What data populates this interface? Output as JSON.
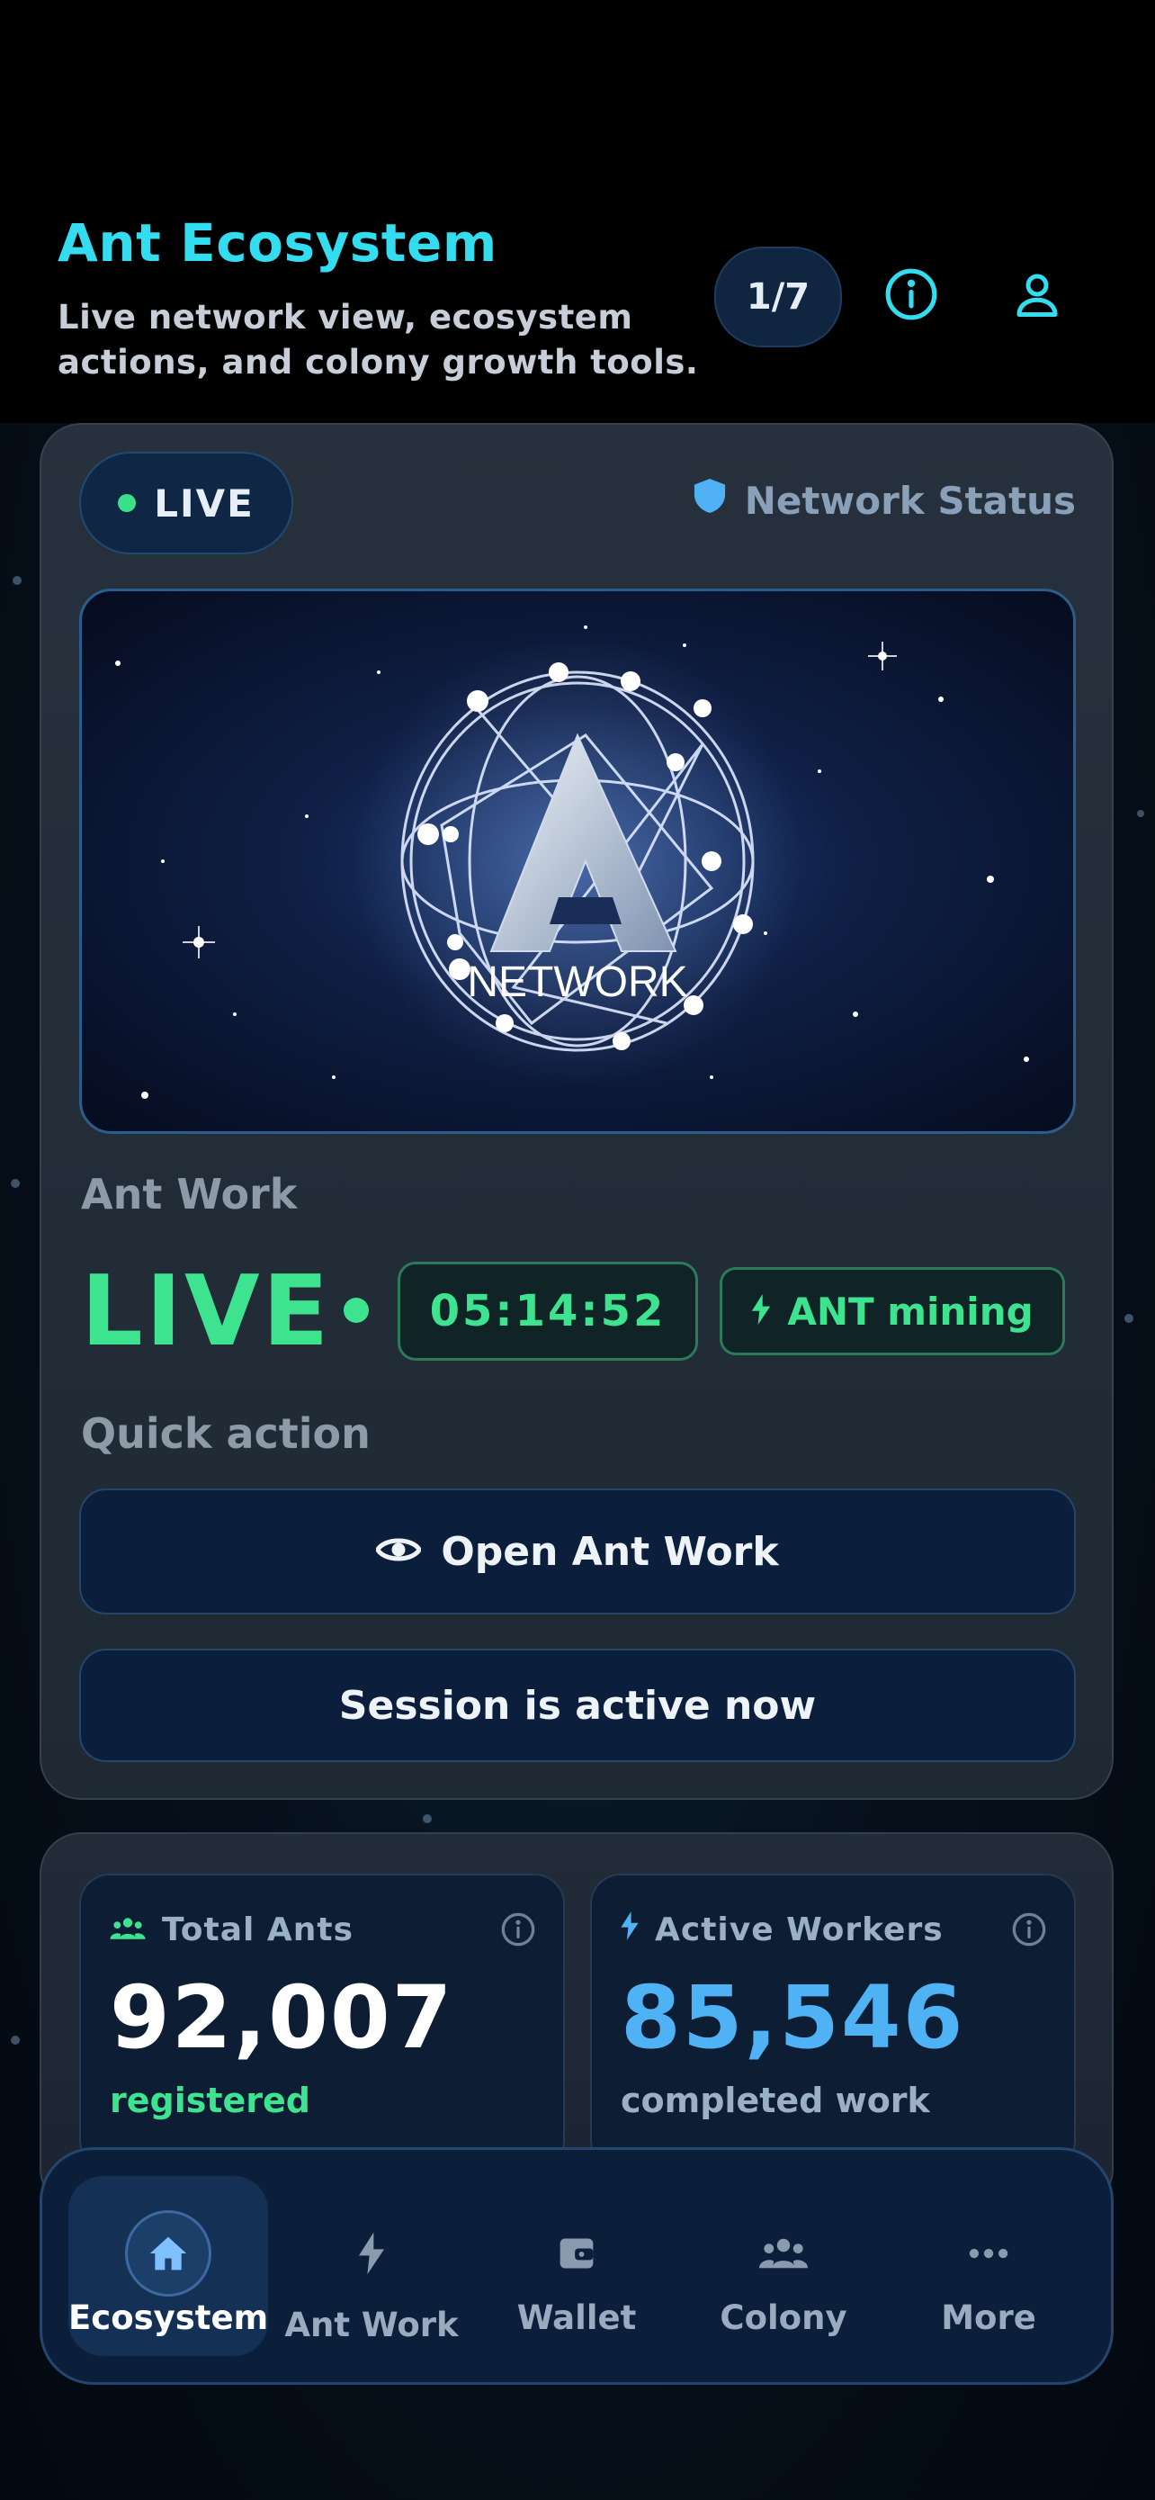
{
  "header": {
    "title": "Ant Ecosystem",
    "subtitle": "Live network view, ecosystem actions, and colony growth tools.",
    "page_indicator": "1/7",
    "info_icon": "info-icon",
    "profile_icon": "user-icon"
  },
  "network_card": {
    "status_badge": "LIVE",
    "network_status_label": "Network Status",
    "hero_logo_text": "NETWORK",
    "ant_work_label": "Ant Work",
    "live_text": "LIVE",
    "timer": "05:14:52",
    "mining_label": "ANT mining",
    "quick_action_label": "Quick action",
    "open_button_label": "Open Ant Work",
    "session_button_label": "Session is active now"
  },
  "stats": [
    {
      "title": "Total Ants",
      "value": "92,007",
      "sub": "registered",
      "icon": "people-icon",
      "value_color": "#ffffff",
      "sub_color": "#3ee38f"
    },
    {
      "title": "Active Workers",
      "value": "85,546",
      "sub": "completed work",
      "icon": "bolt-icon",
      "value_color": "#4fb2f5",
      "sub_color": "#9ab0c6"
    }
  ],
  "bottom_nav": {
    "items": [
      {
        "label": "Ecosystem",
        "icon": "home-icon",
        "active": true
      },
      {
        "label": "Ant Work",
        "icon": "bolt-icon",
        "active": false
      },
      {
        "label": "Wallet",
        "icon": "wallet-icon",
        "active": false
      },
      {
        "label": "Colony",
        "icon": "people-icon",
        "active": false
      },
      {
        "label": "More",
        "icon": "more-icon",
        "active": false
      }
    ]
  },
  "colors": {
    "accent_cyan": "#34dcf0",
    "live_green": "#3ee38f",
    "stat_blue": "#4fb2f5",
    "card_bg": "#27313d",
    "nav_bg": "#0c1f3a"
  }
}
